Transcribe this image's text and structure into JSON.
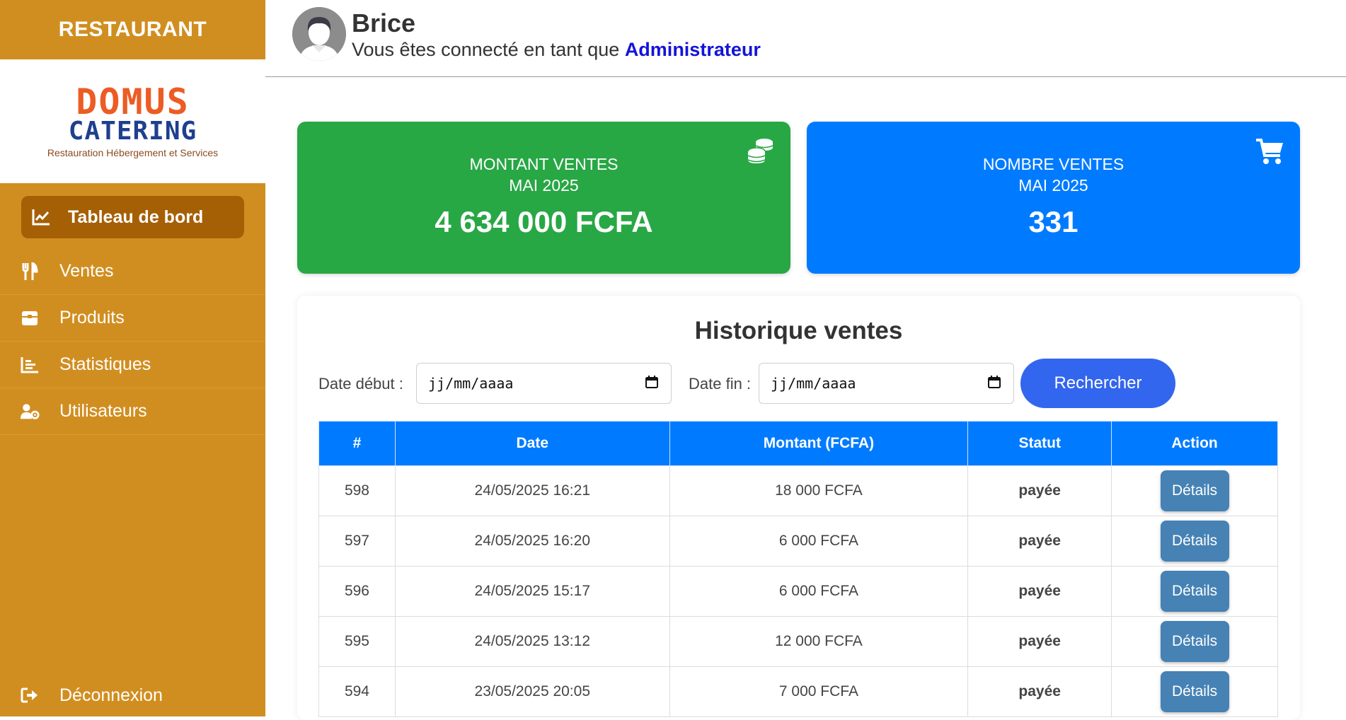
{
  "sidebar": {
    "brand": "RESTAURANT",
    "logo": {
      "line1": "DOMUS",
      "line2": "CATERING",
      "tagline": "Restauration Hébergement et Services"
    },
    "active_item": "Tableau de bord",
    "items": [
      "Ventes",
      "Produits",
      "Statistiques",
      "Utilisateurs"
    ],
    "logout": "Déconnexion"
  },
  "header": {
    "user_name": "Brice",
    "connected_as": "Vous êtes connecté en tant que",
    "role": "Administrateur"
  },
  "cards": {
    "amount": {
      "label_line1": "MONTANT VENTES",
      "label_line2": "MAI 2025",
      "value": "4 634 000 FCFA",
      "color": "#28a745"
    },
    "count": {
      "label_line1": "NOMBRE VENTES",
      "label_line2": "MAI 2025",
      "value": "331",
      "color": "#007bff"
    }
  },
  "history": {
    "title": "Historique ventes",
    "start_label": "Date début :",
    "end_label": "Date fin :",
    "date_placeholder": "jj/mm/aaaa",
    "search_button": "Rechercher",
    "columns": [
      "#",
      "Date",
      "Montant (FCFA)",
      "Statut",
      "Action"
    ],
    "rows": [
      {
        "id": "598",
        "date": "24/05/2025 16:21",
        "amount": "18 000 FCFA",
        "status": "payée",
        "action": "Détails"
      },
      {
        "id": "597",
        "date": "24/05/2025 16:20",
        "amount": "6 000 FCFA",
        "status": "payée",
        "action": "Détails"
      },
      {
        "id": "596",
        "date": "24/05/2025 15:17",
        "amount": "6 000 FCFA",
        "status": "payée",
        "action": "Détails"
      },
      {
        "id": "595",
        "date": "24/05/2025 13:12",
        "amount": "12 000 FCFA",
        "status": "payée",
        "action": "Détails"
      },
      {
        "id": "594",
        "date": "23/05/2025 20:05",
        "amount": "7 000 FCFA",
        "status": "payée",
        "action": "Détails"
      }
    ]
  },
  "icons": {
    "dashboard": "chart-line-icon",
    "sales": "utensils-icon",
    "products": "box-icon",
    "stats": "bar-chart-icon",
    "users": "user-gear-icon",
    "logout": "sign-out-icon",
    "coins": "coins-icon",
    "cart": "cart-icon",
    "calendar": "calendar-icon"
  },
  "colors": {
    "sidebar": "#d18e20",
    "sidebar_active": "#a56006",
    "table_header": "#007bff",
    "search_button": "#3366ee",
    "details_button": "#4682b4",
    "paid": "#1a8a1a",
    "role": "#1414d9"
  }
}
